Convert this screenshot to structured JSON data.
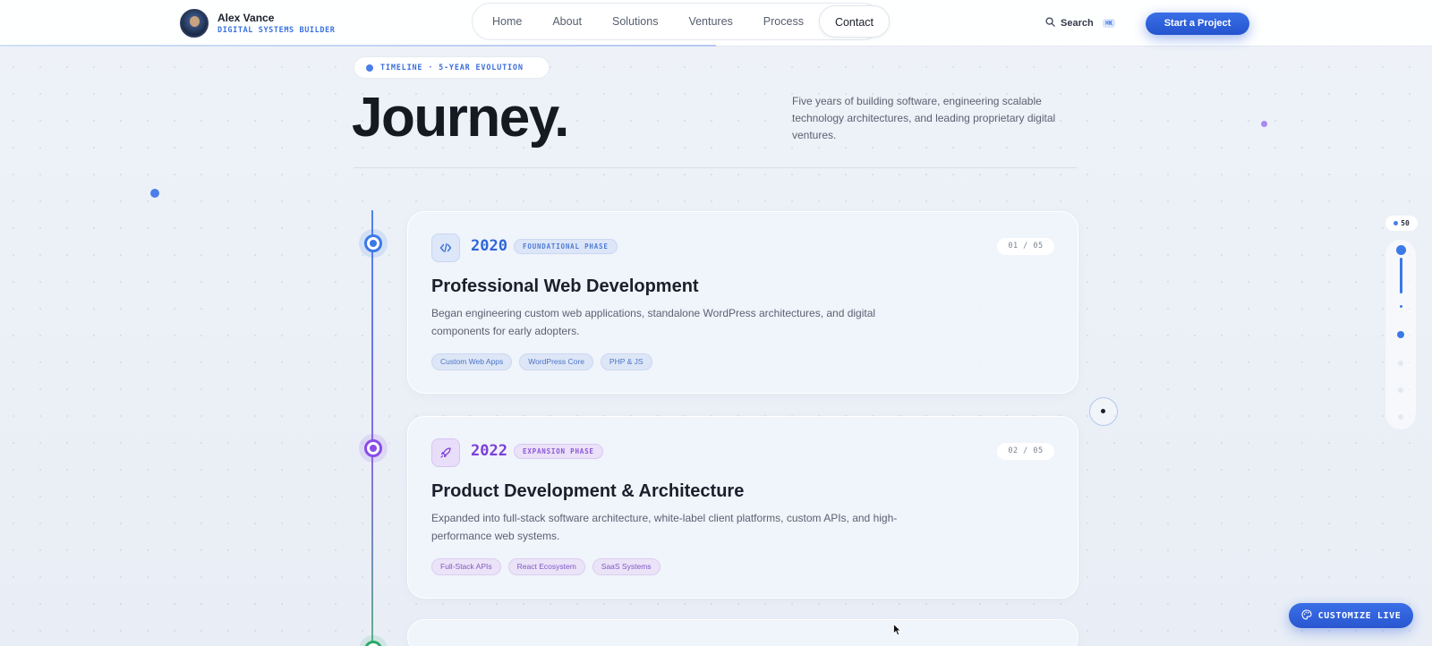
{
  "brand": {
    "name": "Alex Vance",
    "subtitle": "DIGITAL SYSTEMS BUILDER"
  },
  "nav": {
    "items": [
      "Home",
      "About",
      "Solutions",
      "Ventures",
      "Process",
      "Contact"
    ],
    "active": "Contact"
  },
  "search": {
    "label": "Search",
    "shortcut": "⌘K"
  },
  "cta": {
    "label": "Start a Project"
  },
  "hero": {
    "pill": "TIMELINE · 5-YEAR EVOLUTION",
    "title": "Journey.",
    "description": "Five years of building software, engineering scalable technology architectures, and leading proprietary digital ventures."
  },
  "timeline": [
    {
      "year": "2020",
      "phase": "FOUNDATIONAL PHASE",
      "counter": "01 / 05",
      "icon": "code-icon",
      "title": "Professional Web Development",
      "description": "Began engineering custom web applications, standalone WordPress architectures, and digital components for early adopters.",
      "tags": [
        "Custom Web Apps",
        "WordPress Core",
        "PHP & JS"
      ],
      "accent": "#2f66d8"
    },
    {
      "year": "2022",
      "phase": "EXPANSION PHASE",
      "counter": "02 / 05",
      "icon": "rocket-icon",
      "title": "Product Development & Architecture",
      "description": "Expanded into full-stack software architecture, white-label client platforms, custom APIs, and high-performance web systems.",
      "tags": [
        "Full-Stack APIs",
        "React Ecosystem",
        "SaaS Systems"
      ],
      "accent": "#7b3fd8"
    }
  ],
  "scroll_indicator": {
    "value": "50"
  },
  "customize": {
    "label": "CUSTOMIZE LIVE"
  },
  "colors": {
    "primary": "#2f66d8",
    "purple": "#7b3fd8",
    "green": "#2aa86a",
    "background": "#eef2f8"
  }
}
